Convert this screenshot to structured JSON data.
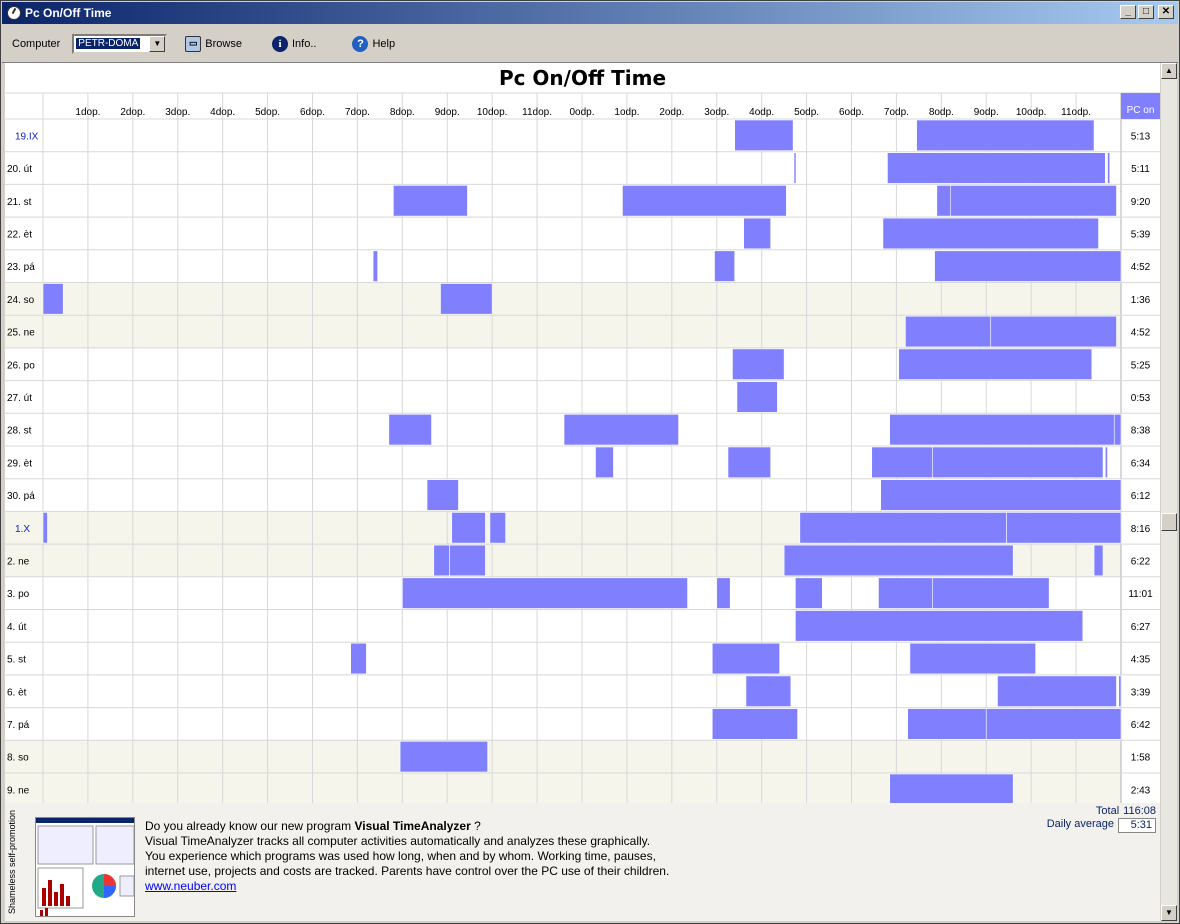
{
  "window": {
    "title": "Pc On/Off Time",
    "buttons": [
      "_",
      "□",
      "✕"
    ]
  },
  "toolbar": {
    "computer_label": "Computer",
    "computer_value": "PETR-DOMA",
    "browse_label": "Browse",
    "info_label": "Info..",
    "help_label": "Help"
  },
  "chart_data": {
    "type": "timeline",
    "title": "Pc On/Off Time",
    "hour_labels": [
      "1dop.",
      "2dop.",
      "3dop.",
      "4dop.",
      "5dop.",
      "6dop.",
      "7dop.",
      "8dop.",
      "9dop.",
      "10dop.",
      "11dop.",
      "0odp.",
      "1odp.",
      "2odp.",
      "3odp.",
      "4odp.",
      "5odp.",
      "6odp.",
      "7odp.",
      "8odp.",
      "9odp.",
      "10odp.",
      "11odp."
    ],
    "total_column_label": "PC on",
    "rows": [
      {
        "day": "19.IX",
        "weekend": false,
        "highlight": true,
        "total": "5:13",
        "intervals": [
          [
            15.4,
            16.7
          ],
          [
            19.45,
            23.4
          ]
        ]
      },
      {
        "day": "20. út",
        "weekend": false,
        "highlight": false,
        "total": "5:11",
        "intervals": [
          [
            16.72,
            16.76
          ],
          [
            18.8,
            23.65
          ],
          [
            23.7,
            23.75
          ]
        ]
      },
      {
        "day": "21. st",
        "weekend": false,
        "highlight": false,
        "total": "9:20",
        "intervals": [
          [
            7.8,
            9.45
          ],
          [
            12.9,
            16.55
          ],
          [
            19.9,
            20.2
          ],
          [
            20.2,
            23.9
          ]
        ]
      },
      {
        "day": "22. èt",
        "weekend": false,
        "highlight": false,
        "total": "5:39",
        "intervals": [
          [
            15.6,
            16.2
          ],
          [
            18.7,
            23.5
          ]
        ]
      },
      {
        "day": "23. pá",
        "weekend": false,
        "highlight": false,
        "total": "4:52",
        "intervals": [
          [
            7.35,
            7.45
          ],
          [
            14.95,
            15.4
          ],
          [
            19.85,
            24
          ]
        ]
      },
      {
        "day": "24. so",
        "weekend": true,
        "highlight": false,
        "total": "1:36",
        "intervals": [
          [
            0,
            0.45
          ],
          [
            8.85,
            10.0
          ]
        ]
      },
      {
        "day": "25. ne",
        "weekend": true,
        "highlight": false,
        "total": "4:52",
        "intervals": [
          [
            19.2,
            21.1
          ],
          [
            21.1,
            23.9
          ]
        ]
      },
      {
        "day": "26. po",
        "weekend": false,
        "highlight": false,
        "total": "5:25",
        "intervals": [
          [
            15.35,
            16.5
          ],
          [
            19.05,
            23.35
          ]
        ]
      },
      {
        "day": "27. út",
        "weekend": false,
        "highlight": false,
        "total": "0:53",
        "intervals": [
          [
            15.45,
            16.35
          ]
        ]
      },
      {
        "day": "28. st",
        "weekend": false,
        "highlight": false,
        "total": "8:38",
        "intervals": [
          [
            7.7,
            8.65
          ],
          [
            11.6,
            14.15
          ],
          [
            18.85,
            23.85
          ],
          [
            23.85,
            24
          ]
        ]
      },
      {
        "day": "29. èt",
        "weekend": false,
        "highlight": false,
        "total": "6:34",
        "intervals": [
          [
            12.3,
            12.7
          ],
          [
            15.25,
            16.2
          ],
          [
            18.45,
            19.8
          ],
          [
            19.8,
            23.6
          ],
          [
            23.65,
            23.7
          ]
        ]
      },
      {
        "day": "30. pá",
        "weekend": false,
        "highlight": false,
        "total": "6:12",
        "intervals": [
          [
            8.55,
            9.25
          ],
          [
            18.65,
            24
          ]
        ]
      },
      {
        "day": "1.X",
        "weekend": true,
        "highlight": true,
        "total": "8:16",
        "intervals": [
          [
            0,
            0.1
          ],
          [
            9.1,
            9.85
          ],
          [
            9.95,
            10.3
          ],
          [
            16.85,
            21.45
          ],
          [
            21.45,
            24
          ]
        ]
      },
      {
        "day": "2. ne",
        "weekend": true,
        "highlight": false,
        "total": "6:22",
        "intervals": [
          [
            8.7,
            9.05
          ],
          [
            9.05,
            9.85
          ],
          [
            16.5,
            21.6
          ],
          [
            23.4,
            23.6
          ]
        ]
      },
      {
        "day": "3. po",
        "weekend": false,
        "highlight": false,
        "total": "11:01",
        "intervals": [
          [
            8.0,
            14.35
          ],
          [
            15.0,
            15.3
          ],
          [
            16.75,
            17.35
          ],
          [
            18.6,
            19.8
          ],
          [
            19.8,
            22.4
          ]
        ]
      },
      {
        "day": "4. út",
        "weekend": false,
        "highlight": false,
        "total": "6:27",
        "intervals": [
          [
            16.75,
            23.15
          ]
        ]
      },
      {
        "day": "5. st",
        "weekend": false,
        "highlight": false,
        "total": "4:35",
        "intervals": [
          [
            6.85,
            7.2
          ],
          [
            14.9,
            16.4
          ],
          [
            19.3,
            22.1
          ]
        ]
      },
      {
        "day": "6. èt",
        "weekend": false,
        "highlight": false,
        "total": "3:39",
        "intervals": [
          [
            15.65,
            16.65
          ],
          [
            21.25,
            23.9
          ],
          [
            23.95,
            24
          ]
        ]
      },
      {
        "day": "7. pá",
        "weekend": false,
        "highlight": false,
        "total": "6:42",
        "intervals": [
          [
            14.9,
            16.8
          ],
          [
            19.25,
            21.0
          ],
          [
            21.0,
            24
          ]
        ]
      },
      {
        "day": "8. so",
        "weekend": true,
        "highlight": false,
        "total": "1:58",
        "intervals": [
          [
            7.95,
            9.9
          ]
        ]
      },
      {
        "day": "9. ne",
        "weekend": true,
        "highlight": false,
        "total": "2:43",
        "intervals": [
          [
            18.85,
            21.6
          ]
        ]
      }
    ],
    "bar_color": "#8080ff",
    "weekend_row_color": "#f5f5ec",
    "grid_color": "#d8d8d8"
  },
  "footer": {
    "side_label": "Shameless self-promotion",
    "promo_prefix": "Do you already know our new program",
    "promo_product": "Visual TimeAnalyzer",
    "promo_suffix": " ?",
    "line2": "Visual TimeAnalyzer tracks all computer activities automatically and analyzes these graphically.",
    "line3": "You experience which programs was used how long, when and by whom. Working time, pauses,",
    "line4": "internet use, projects and costs are tracked. Parents have control over the PC use of their children.",
    "link": "www.neuber.com",
    "total_label": "Total",
    "total_value": "116:08",
    "avg_label": "Daily average",
    "avg_value": "5:31"
  }
}
